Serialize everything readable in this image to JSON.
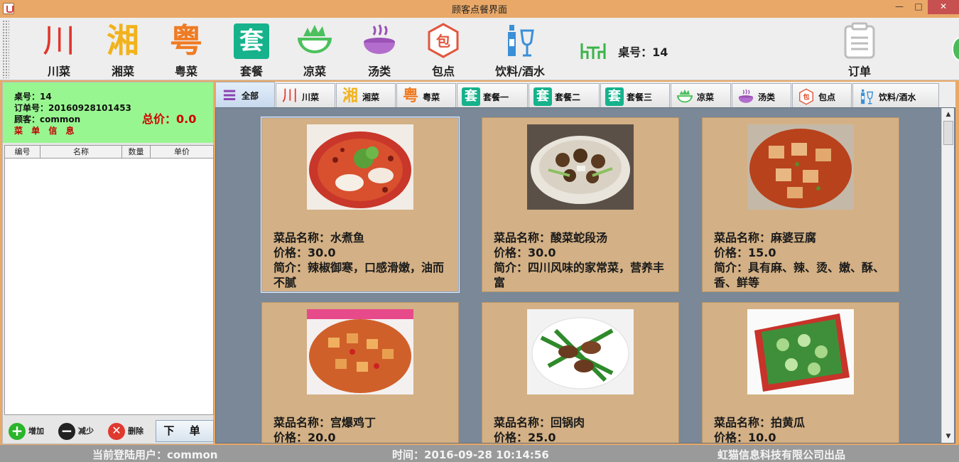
{
  "window": {
    "title": "顾客点餐界面",
    "minimize": "—",
    "maximize": "□",
    "close": "✕"
  },
  "toolbar": {
    "items": [
      {
        "label": "川菜",
        "glyph": "川",
        "icon": "chuan-cuisine-icon"
      },
      {
        "label": "湘菜",
        "glyph": "湘",
        "icon": "xiang-cuisine-icon"
      },
      {
        "label": "粤菜",
        "glyph": "粤",
        "icon": "yue-cuisine-icon"
      },
      {
        "label": "套餐",
        "glyph": "套",
        "icon": "set-meal-icon"
      },
      {
        "label": "凉菜",
        "glyph": "",
        "icon": "salad-bowl-icon"
      },
      {
        "label": "汤类",
        "glyph": "",
        "icon": "soup-bowl-icon"
      },
      {
        "label": "包点",
        "glyph": "包",
        "icon": "bun-icon"
      },
      {
        "label": "饮料/酒水",
        "glyph": "",
        "icon": "drinks-icon"
      }
    ],
    "table_label": "桌号：14",
    "orders_label": "订单"
  },
  "order": {
    "table_no": "桌号：14",
    "order_no": "订单号：20160928101453",
    "customer": "顾客：common",
    "section_title": "菜 单 信 息",
    "total": "总价：0.0",
    "columns": [
      "编号",
      "名称",
      "数量",
      "单价"
    ],
    "rows": [],
    "actions": {
      "add": "增加",
      "reduce": "减少",
      "delete": "删除",
      "submit": "下 单"
    }
  },
  "tabs": [
    {
      "label": "全部",
      "glyph": "≡",
      "icon": "all-list-icon"
    },
    {
      "label": "川菜",
      "glyph": "川",
      "icon": "chuan-cuisine-icon"
    },
    {
      "label": "湘菜",
      "glyph": "湘",
      "icon": "xiang-cuisine-icon"
    },
    {
      "label": "粤菜",
      "glyph": "粤",
      "icon": "yue-cuisine-icon"
    },
    {
      "label": "套餐一",
      "glyph": "套",
      "icon": "set-meal-icon"
    },
    {
      "label": "套餐二",
      "glyph": "套",
      "icon": "set-meal-icon"
    },
    {
      "label": "套餐三",
      "glyph": "套",
      "icon": "set-meal-icon"
    },
    {
      "label": "凉菜",
      "glyph": "",
      "icon": "salad-bowl-icon"
    },
    {
      "label": "汤类",
      "glyph": "",
      "icon": "soup-bowl-icon"
    },
    {
      "label": "包点",
      "glyph": "包",
      "icon": "bun-icon"
    },
    {
      "label": "饮料/酒水",
      "glyph": "",
      "icon": "drinks-icon"
    }
  ],
  "dishes": [
    {
      "name": "菜品名称：水煮鱼",
      "price": "价格：30.0",
      "desc": "简介：辣椒御寒，口感滑嫩，油而不腻"
    },
    {
      "name": "菜品名称：酸菜蛇段汤",
      "price": "价格：30.0",
      "desc": "简介：四川风味的家常菜，营养丰富"
    },
    {
      "name": "菜品名称：麻婆豆腐",
      "price": "价格：15.0",
      "desc": "简介：具有麻、辣、烫、嫩、酥、香、鲜等"
    },
    {
      "name": "菜品名称：宫爆鸡丁",
      "price": "价格：20.0",
      "desc": ""
    },
    {
      "name": "菜品名称：回锅肉",
      "price": "价格：25.0",
      "desc": ""
    },
    {
      "name": "菜品名称：拍黄瓜",
      "price": "价格：10.0",
      "desc": ""
    }
  ],
  "status": {
    "user": "当前登陆用户：common",
    "time": "时间：2016-09-28 10:14:56",
    "company": "虹猫信息科技有限公司出品"
  },
  "colors": {
    "titlebar": "#e9a867",
    "order_panel": "#98f690",
    "total": "#d00000",
    "card": "#d3b085",
    "content_bg": "#7a8897"
  }
}
